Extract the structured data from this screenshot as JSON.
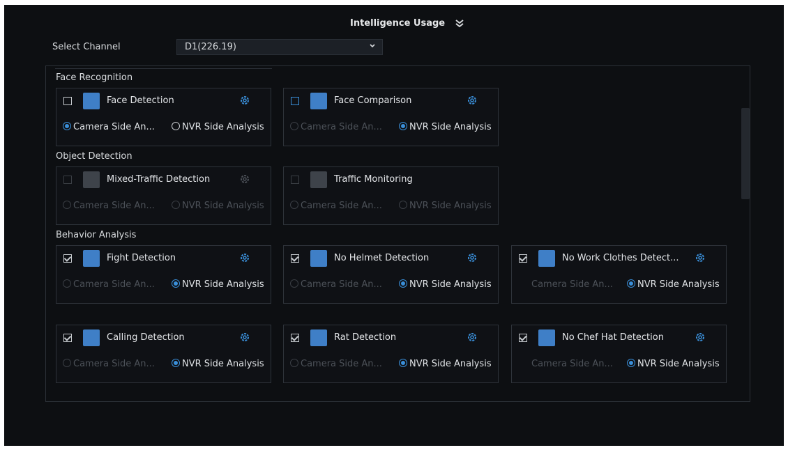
{
  "header": {
    "title": "Intelligence Usage"
  },
  "channel": {
    "label": "Select Channel",
    "value": "D1(226.19)"
  },
  "sections": {
    "face": "Face Recognition",
    "object": "Object Detection",
    "behavior": "Behavior Analysis"
  },
  "cards": [
    {
      "title": "Face Detection",
      "opt1": "Camera Side An...",
      "opt2": "NVR Side Analysis"
    },
    {
      "title": "Face Comparison",
      "opt1": "Camera Side An...",
      "opt2": "NVR Side Analysis"
    },
    {
      "title": "Mixed-Traffic Detection",
      "opt1": "Camera Side An...",
      "opt2": "NVR Side Analysis"
    },
    {
      "title": "Traffic Monitoring",
      "opt1": "Camera Side An...",
      "opt2": "NVR Side Analysis"
    },
    {
      "title": "Fight Detection",
      "opt1": "Camera Side An...",
      "opt2": "NVR Side Analysis"
    },
    {
      "title": "No Helmet Detection",
      "opt1": "Camera Side An...",
      "opt2": "NVR Side Analysis"
    },
    {
      "title": "No Work Clothes Detect...",
      "opt1": "Camera Side An...",
      "opt2": "NVR Side Analysis"
    },
    {
      "title": "Calling Detection",
      "opt1": "Camera Side An...",
      "opt2": "NVR Side Analysis"
    },
    {
      "title": "Rat Detection",
      "opt1": "Camera Side An...",
      "opt2": "NVR Side Analysis"
    },
    {
      "title": "No Chef Hat Detection",
      "opt1": "Camera Side An...",
      "opt2": "NVR Side Analysis"
    }
  ],
  "colors": {
    "accent": "#3a8fd9",
    "background": "#0d0f12",
    "disabled": "#4c5158"
  }
}
